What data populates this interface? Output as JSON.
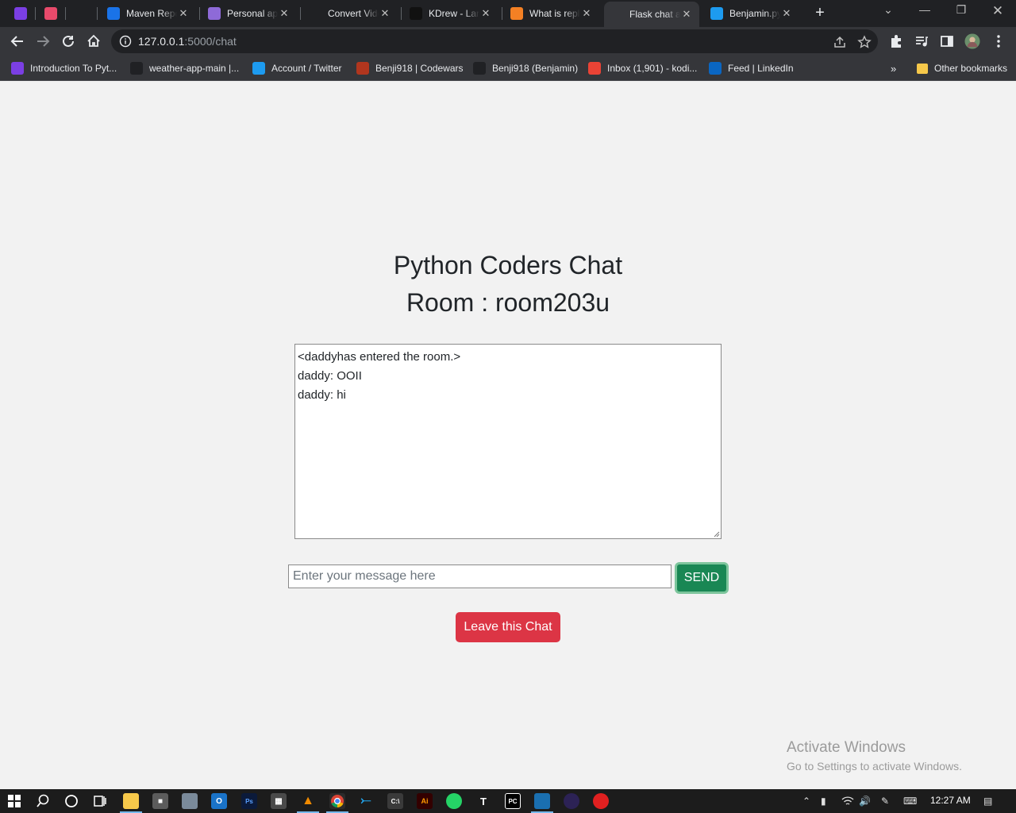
{
  "browser": {
    "tabs": [
      {
        "title": "",
        "icon": "purple-u-icon",
        "color": "#7b3fe4"
      },
      {
        "title": "",
        "icon": "pink-eraser-icon",
        "color": "#e84a6b"
      },
      {
        "title": "",
        "icon": "github-icon",
        "color": "#202124"
      },
      {
        "title": "Maven Repository",
        "icon": "mvn-icon",
        "color": "#1a73e8"
      },
      {
        "title": "Personal app",
        "icon": "k-icon",
        "color": "#8e6ad8"
      },
      {
        "title": "Convert Video",
        "icon": "download-icon",
        "color": "#202124"
      },
      {
        "title": "KDrew - Lane",
        "icon": "play-icon",
        "color": "#111111"
      },
      {
        "title": "What is repl",
        "icon": "stackoverflow-icon",
        "color": "#f48024"
      },
      {
        "title": "Flask chat app",
        "icon": "globe-icon",
        "color": "#35363a",
        "active": true
      },
      {
        "title": "Benjamin.py",
        "icon": "twitter-icon",
        "color": "#1d9bf0"
      }
    ],
    "url": {
      "host": "127.0.0.1",
      "path": ":5000/chat"
    },
    "bookmarks": [
      {
        "label": "Introduction To Pyt...",
        "icon": "purple-u-icon",
        "color": "#7b3fe4"
      },
      {
        "label": "weather-app-main |...",
        "icon": "github-icon",
        "color": "#202124"
      },
      {
        "label": "Account / Twitter",
        "icon": "twitter-icon",
        "color": "#1d9bf0"
      },
      {
        "label": "Benji918 | Codewars",
        "icon": "codewars-icon",
        "color": "#b1361e"
      },
      {
        "label": "Benji918 (Benjamin)",
        "icon": "github-icon",
        "color": "#202124"
      },
      {
        "label": "Inbox (1,901) - kodi...",
        "icon": "gmail-icon",
        "color": "#ea4335"
      },
      {
        "label": "Feed | LinkedIn",
        "icon": "linkedin-icon",
        "color": "#0a66c2"
      }
    ],
    "other_bookmarks": "Other bookmarks"
  },
  "page": {
    "heading": "Python Coders Chat",
    "room_prefix": "Room : ",
    "room": "room203u",
    "chat_lines": [
      "<daddyhas entered the room.>",
      "daddy: OOII",
      "daddy: hi"
    ],
    "message_placeholder": "Enter your message here",
    "send_label": "SEND",
    "leave_label": "Leave this Chat"
  },
  "activation": {
    "title": "Activate Windows",
    "subtitle": "Go to Settings to activate Windows."
  },
  "taskbar": {
    "time": "12:27 AM"
  }
}
